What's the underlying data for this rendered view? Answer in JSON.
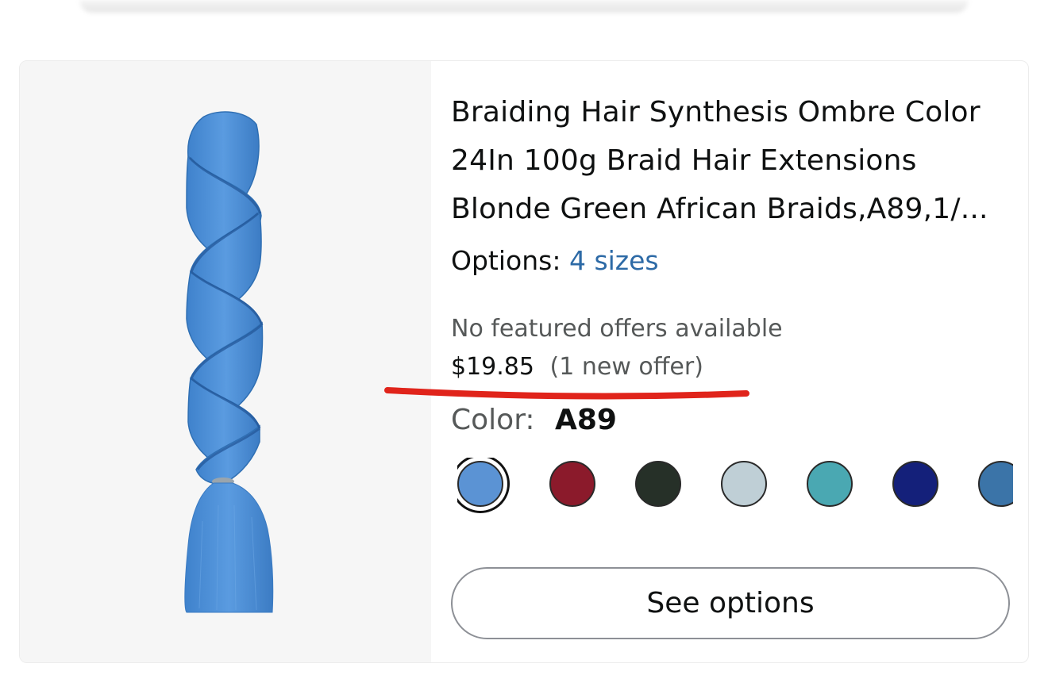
{
  "product": {
    "title": "Braiding Hair Synthesis Ombre Color 24In 100g Braid Hair Extensions Blonde Green African Braids,A89,1/...",
    "image_icon": "braid-hair-image",
    "options_label": "Options:",
    "options_link": "4 sizes",
    "no_offers_text": "No featured offers available",
    "price": "$19.85",
    "offer_count": "(1 new offer)",
    "color_label": "Color:",
    "color_value": "A89",
    "swatches": [
      {
        "color": "#5b93d4",
        "selected": true
      },
      {
        "color": "#8b1a2b",
        "selected": false
      },
      {
        "color": "#263028",
        "selected": false
      },
      {
        "color": "#bfcfd6",
        "selected": false
      },
      {
        "color": "#4aa8b2",
        "selected": false
      },
      {
        "color": "#14207a",
        "selected": false
      },
      {
        "color": "#3b74a8",
        "selected": false
      }
    ],
    "see_options_label": "See options"
  },
  "colors": {
    "link": "#2d6aa6",
    "annotation": "#e0241b",
    "hair": "#4a8fd6"
  }
}
